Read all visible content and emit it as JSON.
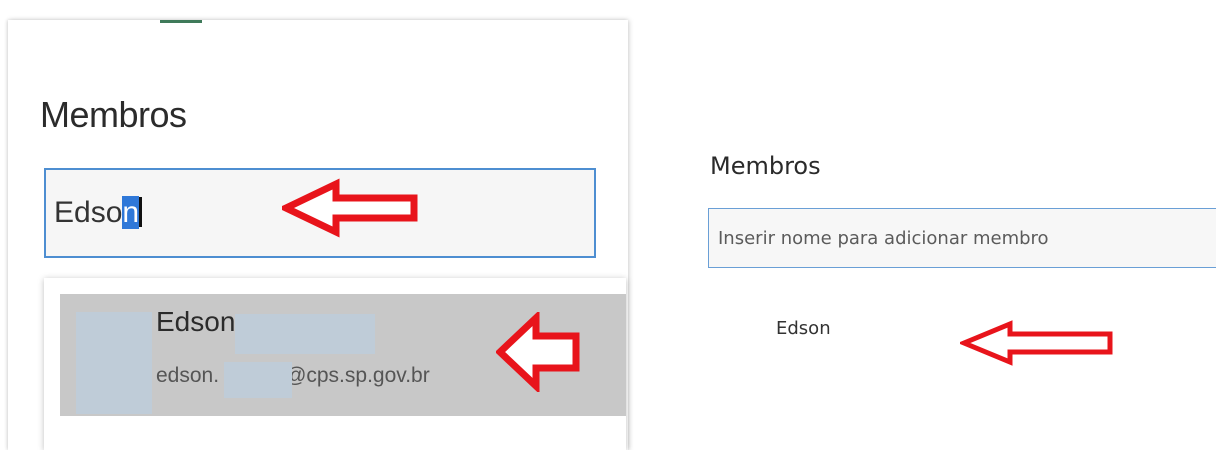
{
  "left": {
    "title": "Membros",
    "input": {
      "typed_prefix": "Edso",
      "typed_selected": "n"
    },
    "suggestion": {
      "name": "Edson",
      "email_prefix": "edson.",
      "email_domain": "@cps.sp.gov.br"
    }
  },
  "right": {
    "title": "Membros",
    "input": {
      "placeholder": "Inserir nome para adicionar membro",
      "value": ""
    },
    "member": {
      "name": "Edson"
    }
  },
  "colors": {
    "annotation_arrow": "#e8141b",
    "input_border": "#4e8ed1",
    "selection": "#2f78d8",
    "suggestion_highlight": "#c8c8c8",
    "redaction": "#bfccd8"
  }
}
